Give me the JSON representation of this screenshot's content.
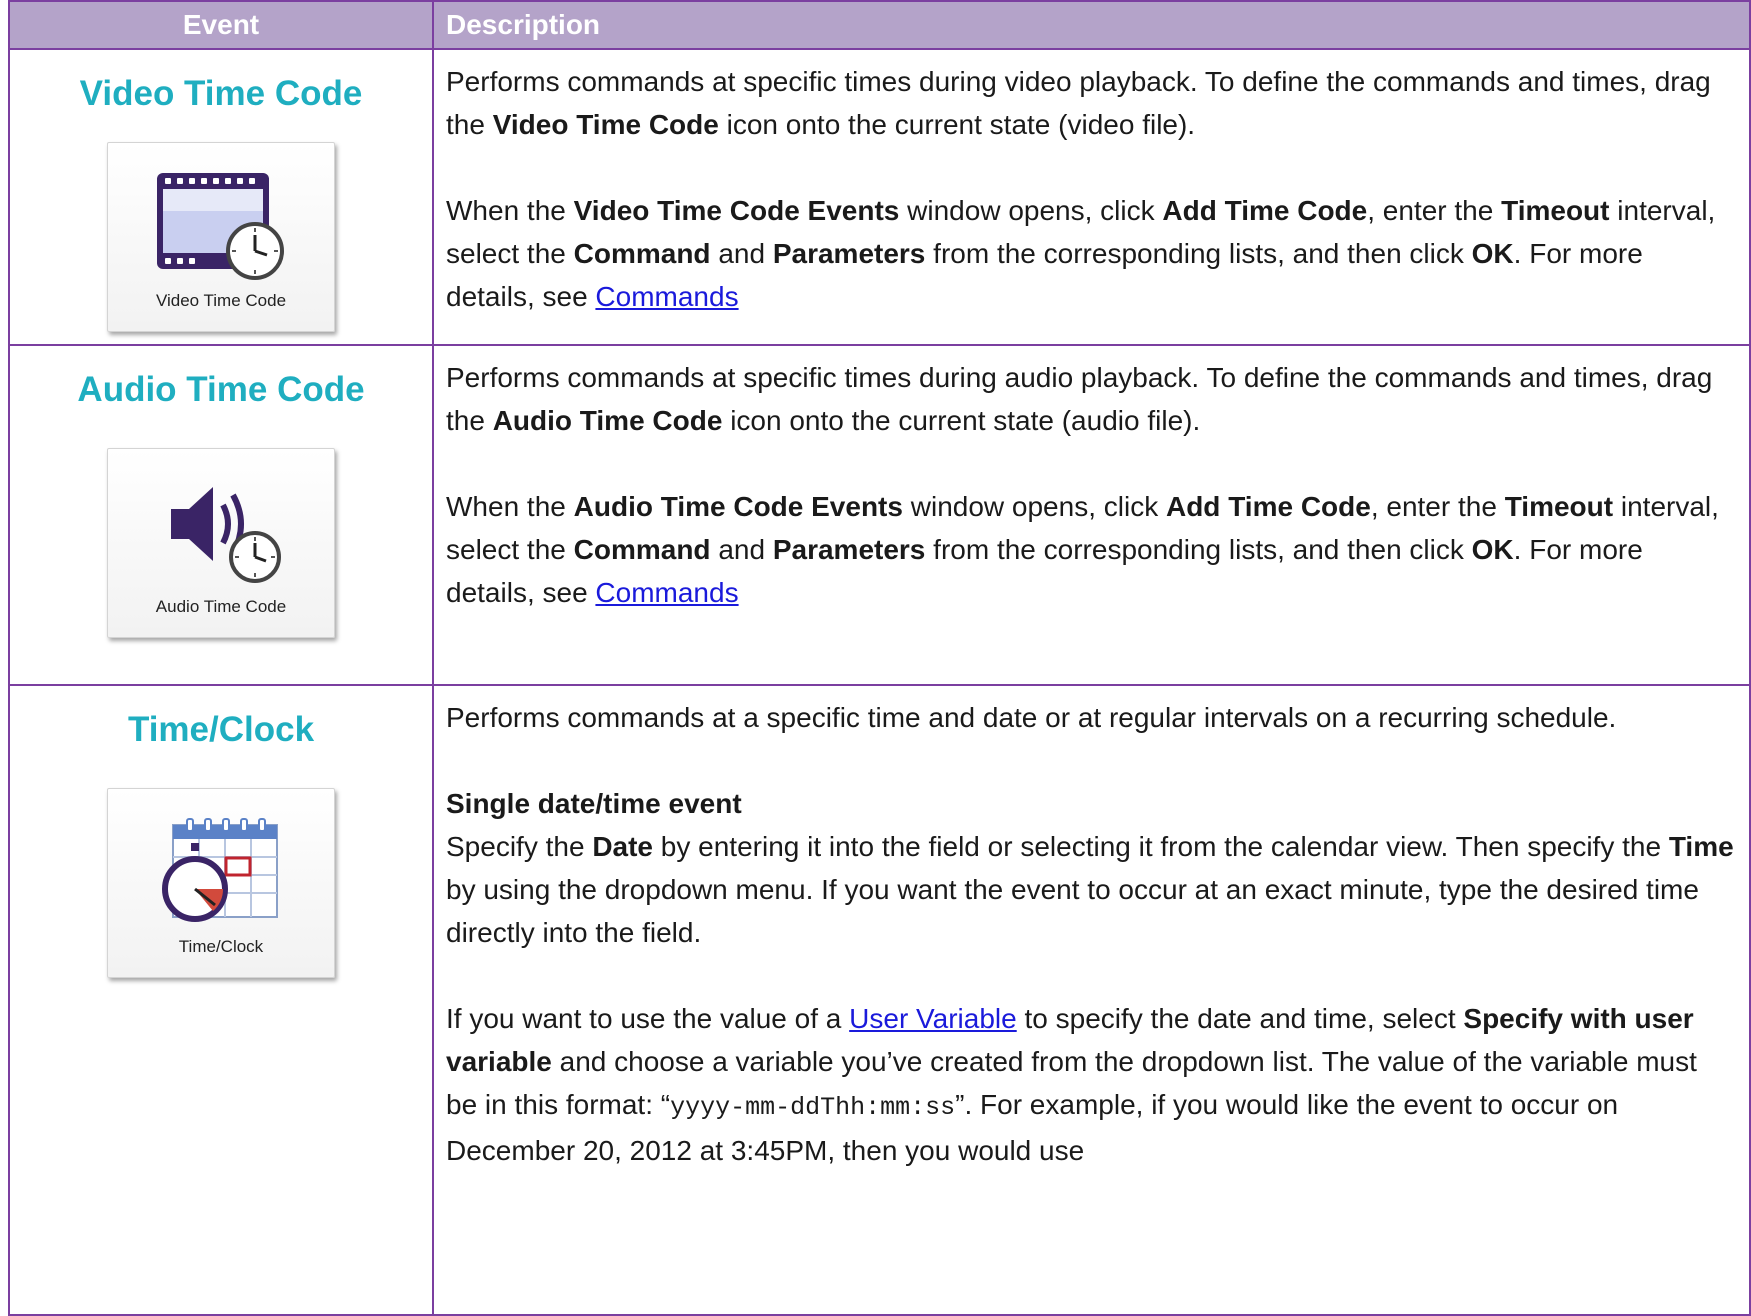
{
  "header": {
    "event": "Event",
    "description": "Description"
  },
  "rows": [
    {
      "title": "Video Time Code",
      "icon_caption": "Video Time Code",
      "icon": "film-clock-icon",
      "p1": [
        "Performs commands at specific times during video playback. To define the commands and times, drag the ",
        "Video Time Code",
        " icon onto the current state (video file)."
      ],
      "p2": [
        "When the ",
        "Video Time Code Events",
        " window opens, click ",
        "Add Time Code",
        ", enter the ",
        "Timeout",
        " interval, select the ",
        "Command",
        " and ",
        "Parameters",
        " from the corresponding lists, and then click ",
        "OK",
        ". For more details, see "
      ],
      "link": "Commands"
    },
    {
      "title": "Audio Time Code",
      "icon_caption": "Audio Time Code",
      "icon": "speaker-clock-icon",
      "p1": [
        "Performs commands at specific times during audio playback. To define the commands and times, drag the ",
        "Audio Time Code",
        " icon onto the current state (audio file)."
      ],
      "p2": [
        "When the ",
        "Audio Time Code Events",
        " window opens, click ",
        "Add Time Code",
        ", enter the ",
        "Timeout",
        " interval, select the ",
        "Command",
        " and ",
        "Parameters",
        " from the corresponding lists, and then click ",
        "OK",
        ". For more details, see "
      ],
      "link": "Commands"
    },
    {
      "title": "Time/Clock",
      "icon_caption": "Time/Clock",
      "icon": "calendar-stopwatch-icon",
      "p1": "Performs commands at a specific time and date or at regular intervals on a recurring schedule.",
      "subhead": "Single date/time event",
      "p2": [
        "Specify the ",
        "Date",
        " by entering it into the field or selecting it from the calendar view. Then specify the ",
        "Time",
        " by using the dropdown menu. If you want the event to occur at an exact minute, type the desired time directly into the field."
      ],
      "p3": [
        "If you want to use the value of a ",
        "User Variable",
        " to specify the date and time, select ",
        "Specify with user variable",
        " and choose a variable you’ve created from the dropdown list. The value of the variable must be in this format: “",
        "yyyy-mm-ddThh:mm:ss",
        "”. For example, if you would like the event to occur on December 20, 2012 at 3:45PM, then you would use"
      ]
    }
  ],
  "colors": {
    "border": "#7b3fa0",
    "header_bg": "#b4a3c9",
    "title": "#1faec0",
    "link": "#1a1adb"
  }
}
